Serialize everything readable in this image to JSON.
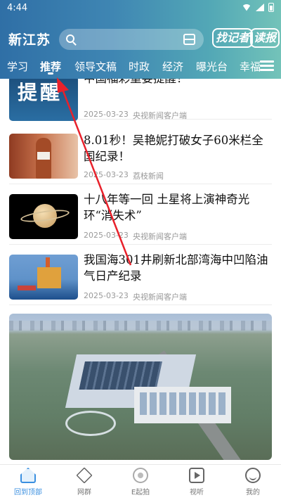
{
  "status_bar": {
    "time": "4:44"
  },
  "header": {
    "brand": "新江苏",
    "button_reporter": "找记者",
    "button_read": "读报"
  },
  "tabs": [
    {
      "label": "学习"
    },
    {
      "label": "推荐"
    },
    {
      "label": "领导文稿"
    },
    {
      "label": "时政"
    },
    {
      "label": "经济"
    },
    {
      "label": "曝光台"
    },
    {
      "label": "幸福"
    }
  ],
  "active_tab": "推荐",
  "news": [
    {
      "title": "中国福彩重要提醒！",
      "date": "2025-03-23",
      "source": "央视新闻客户端",
      "thumb_text": "提醒"
    },
    {
      "title": "8.01秒！吴艳妮打破女子60米栏全国纪录！",
      "date": "2025-03-23",
      "source": "荔枝新闻"
    },
    {
      "title": "十八年等一回 土星将上演神奇光环“消失术”",
      "date": "2025-03-23",
      "source": "央视新闻客户端"
    },
    {
      "title": "我国海301井刷新北部湾海中凹陷油气日产纪录",
      "date": "2025-03-23",
      "source": "央视新闻客户端"
    }
  ],
  "bottom_nav": [
    {
      "label": "回到顶部"
    },
    {
      "label": "网群"
    },
    {
      "label": "E起拍"
    },
    {
      "label": "视听"
    },
    {
      "label": "我的"
    }
  ],
  "colors": {
    "header_start": "#2f6fa6",
    "header_end": "#73c3b9",
    "active_nav": "#3a8fe0",
    "arrow": "#e8212b"
  }
}
